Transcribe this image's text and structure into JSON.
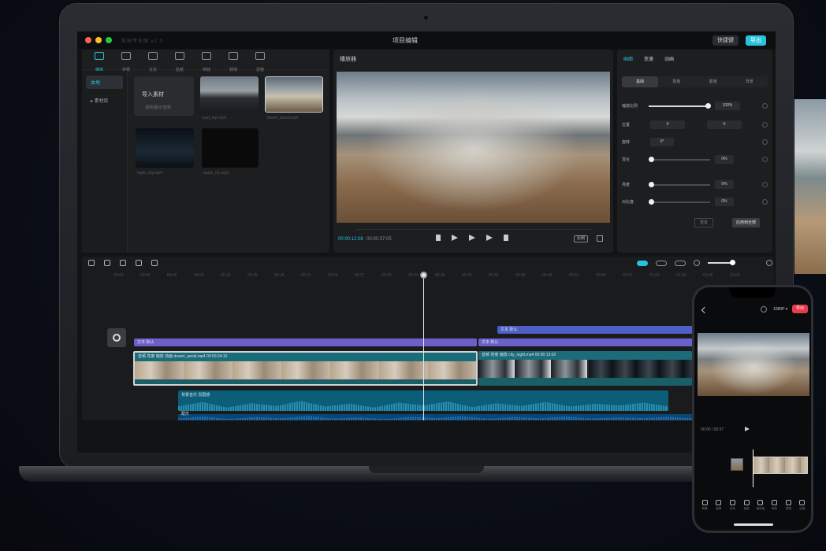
{
  "app": {
    "window_title": "项目编辑",
    "subtitle": "剪映专业版 v1.0",
    "shortcut_label": "快捷键",
    "export_label": "导出"
  },
  "media_panel": {
    "tools": [
      {
        "label": "媒体",
        "icon": "media-icon",
        "active": true
      },
      {
        "label": "音频",
        "icon": "audio-icon"
      },
      {
        "label": "文本",
        "icon": "text-icon"
      },
      {
        "label": "贴纸",
        "icon": "sticker-icon"
      },
      {
        "label": "特效",
        "icon": "effects-icon"
      },
      {
        "label": "转场",
        "icon": "transition-icon"
      },
      {
        "label": "滤镜",
        "icon": "filter-icon"
      }
    ],
    "side_items": [
      "本地",
      "▸ 素材库"
    ],
    "import_label": "导入素材",
    "import_sub": "视频/图片/音频",
    "thumb_labels": [
      "road_trip.mp4",
      "desert_aerial.mp4",
      "night_city.mp4",
      "audio_01.mp3"
    ]
  },
  "preview": {
    "title": "播放器",
    "timecode": "00:00:12:08",
    "total": "00:00:37:05",
    "ratio": "比例"
  },
  "inspector": {
    "tabs": [
      "画面",
      "变速",
      "动画"
    ],
    "segments": [
      "基础",
      "抠像",
      "蒙版",
      "背景"
    ],
    "rows": [
      {
        "label": "缩放比例",
        "value": "100%"
      },
      {
        "label": "位置",
        "x": "0",
        "y": "0"
      },
      {
        "label": "旋转",
        "value": "0°"
      },
      {
        "label": "混合",
        "value": "0%"
      },
      {
        "label": "亮度",
        "value": "0%"
      },
      {
        "label": "对比度",
        "value": "0%"
      }
    ],
    "reset_label": "重置",
    "apply_all_label": "应用到全部"
  },
  "timeline": {
    "ticks": [
      "00:00",
      "00:03",
      "00:06",
      "00:09",
      "00:12",
      "00:15",
      "00:18",
      "00:21",
      "00:24",
      "00:27",
      "00:30",
      "00:33",
      "00:36",
      "00:39",
      "00:42",
      "00:45",
      "00:48",
      "00:51",
      "00:54",
      "00:57",
      "01:00",
      "01:03",
      "01:06",
      "01:09"
    ],
    "text_track_1": "文本 默认",
    "text_track_2": "文本 默认",
    "text_track_3": "文本 默认",
    "clip_1_label": "音频 亮度 缩放 动画 desert_aerial.mp4 00:00:24:10",
    "clip_2_label": "音频 亮度 缩放 city_night.mp4 00:00:13:02",
    "audio_1_label": "背景音乐 氛围感",
    "audio_2_label": "配乐"
  },
  "phone": {
    "resolution": "1080P ▾",
    "export": "导出",
    "time": "00:00 / 00:37",
    "tabs": [
      "剪辑",
      "音频",
      "文本",
      "贴纸",
      "画中画",
      "特效",
      "滤镜",
      "比例"
    ]
  }
}
